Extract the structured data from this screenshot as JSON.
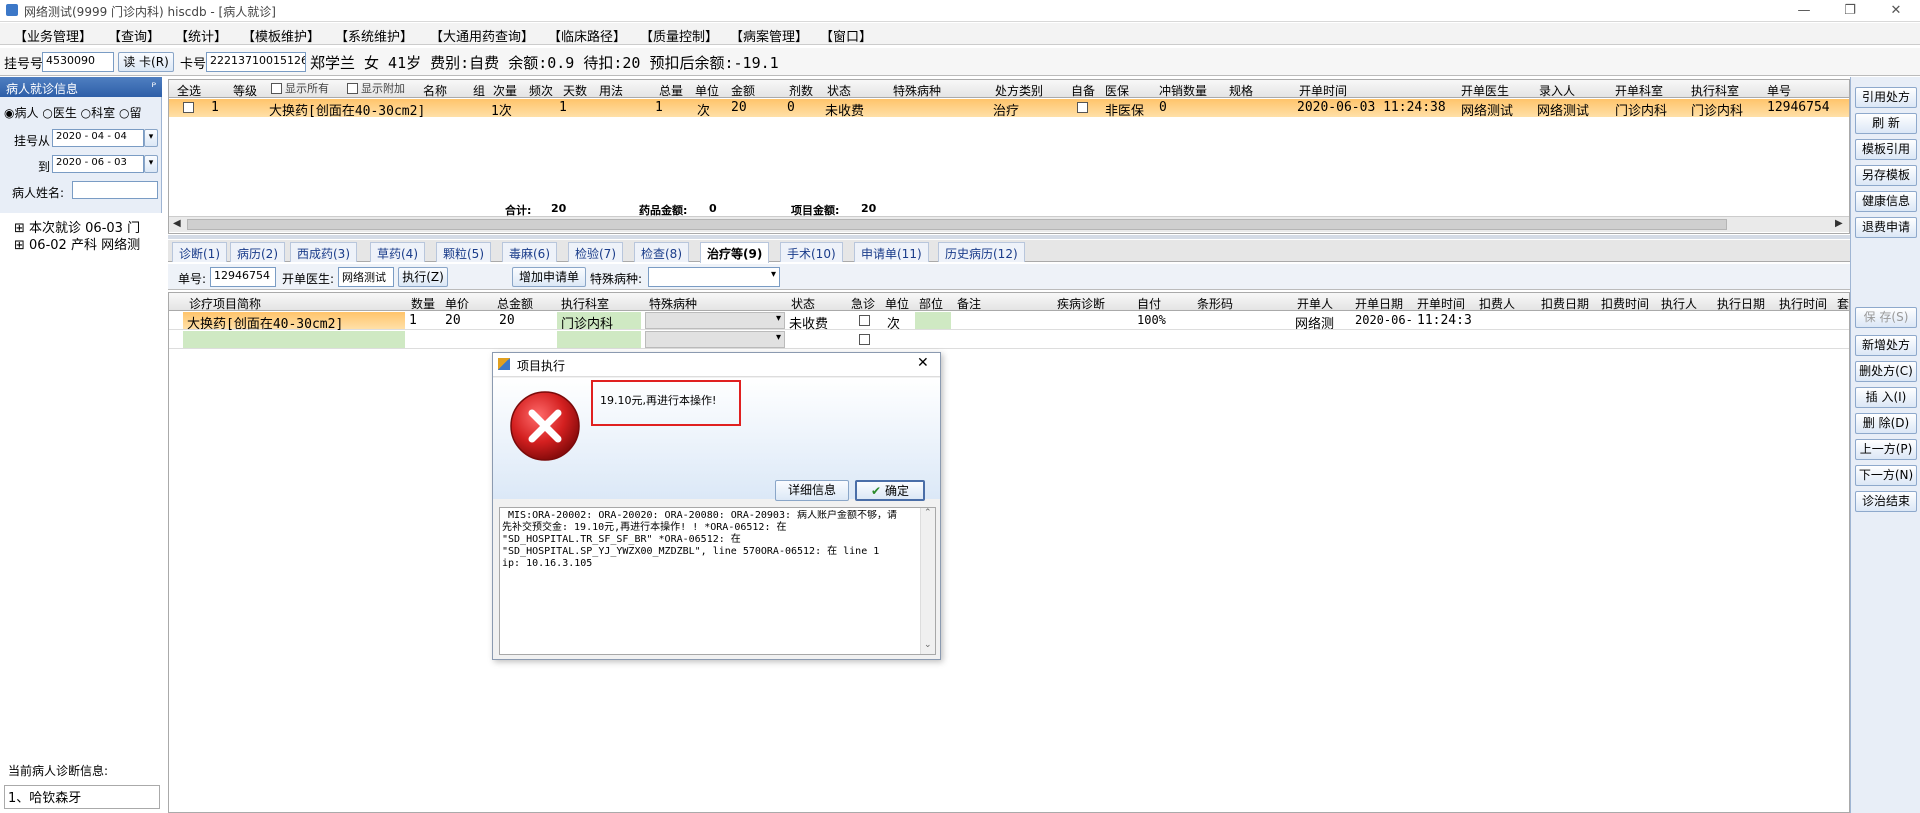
{
  "window": {
    "title": "网络测试(9999 门诊内科)  hiscdb - [病人就诊]",
    "minimize": "—",
    "restore": "❐",
    "close": "✕"
  },
  "menu": [
    "【业务管理】",
    "【查询】",
    "【统计】",
    "【模板维护】",
    "【系统维护】",
    "【大通用药查询】",
    "【临床路径】",
    "【质量控制】",
    "【病案管理】",
    "【窗口】"
  ],
  "patient": {
    "reg_label": "挂号号",
    "reg_no": "4530090",
    "read_card": "读 卡(R)",
    "card_label": "卡号",
    "card_no": "222137100151268",
    "info": "郑学兰  女  41岁  费别:自费  余额:0.9  待扣:20  预扣后余额:-19.1"
  },
  "left": {
    "header": "病人就诊信息",
    "pin": "ᴾ",
    "radios": [
      "病人",
      "医生",
      "科室",
      "留"
    ],
    "from_label": "挂号从",
    "from_date": "2020 - 04 - 04",
    "to_label": "到",
    "to_date": "2020 - 06 - 03",
    "name_label": "病人姓名:",
    "tree": [
      "本次就诊 06-03 门",
      "06-02 产科  网络测"
    ],
    "diag_label": "当前病人诊断信息:",
    "diag_value": "1、哈钦森牙"
  },
  "top_grid": {
    "select_all": "全选",
    "show_all": "显示所有",
    "show_extra": "显示附加",
    "headers": [
      "等级",
      "名称",
      "组",
      "次量",
      "频次",
      "天数",
      "用法",
      "总量",
      "单位",
      "金额",
      "剂数",
      "状态",
      "特殊病种",
      "处方类别",
      "自备",
      "医保",
      "冲销数量",
      "规格",
      "开单时间",
      "开单医生",
      "录入人",
      "开单科室",
      "执行科室",
      "单号"
    ],
    "row": {
      "idx": "1",
      "name": "大换药[创面在40-30cm2]",
      "dose": "1次",
      "freq": "1",
      "total": "1",
      "unit": "次",
      "amount": "20",
      "doses": "0",
      "status": "未收费",
      "category": "治疗",
      "insurance": "非医保",
      "writeoff": "0",
      "time": "2020-06-03 11:24:38",
      "doctor": "网络测试",
      "entered_by": "网络测试",
      "dept": "门诊内科",
      "exec_dept": "门诊内科",
      "order_no": "12946754"
    },
    "totals": {
      "sum_label": "合计:",
      "sum": "20",
      "drug_label": "药品金额:",
      "drug": "0",
      "item_label": "项目金额:",
      "item": "20"
    }
  },
  "tabs": [
    "诊断(1)",
    "病历(2)",
    "西成药(3)",
    "草药(4)",
    "颗粒(5)",
    "毒麻(6)",
    "检验(7)",
    "检查(8)",
    "治疗等(9)",
    "手术(10)",
    "申请单(11)",
    "历史病历(12)"
  ],
  "toolbar": {
    "order_label": "单号:",
    "order_no": "12946754",
    "doctor_label": "开单医生:",
    "doctor": "网络测试",
    "exec": "执行(Z)",
    "add_request": "增加申请单",
    "special_label": "特殊病种:"
  },
  "lower_grid": {
    "headers": [
      "诊疗项目简称",
      "数量",
      "单价",
      "总金额",
      "执行科室",
      "特殊病种",
      "状态",
      "急诊",
      "单位",
      "部位",
      "备注",
      "疾病诊断",
      "自付",
      "条形码",
      "开单人",
      "开单日期",
      "开单时间",
      "扣费人",
      "扣费日期",
      "扣费时间",
      "执行人",
      "执行日期",
      "执行时间",
      "套"
    ],
    "row": {
      "name": "大换药[创面在40-30cm2]",
      "qty": "1",
      "price": "20",
      "total": "20",
      "exec_dept": "门诊内科",
      "status": "未收费",
      "unit": "次",
      "selfpay": "100%",
      "doctor": "网络测",
      "date": "2020-06-",
      "time": "11:24:3"
    }
  },
  "right_buttons": [
    "引用处方",
    "刷 新",
    "模板引用",
    "另存模板",
    "健康信息",
    "退费申请",
    "保 存(S)",
    "新增处方",
    "删处方(C)",
    "插 入(I)",
    "删 除(D)",
    "上一方(P)",
    "下一方(N)",
    "诊治结束"
  ],
  "dialog": {
    "title": "项目执行",
    "close": "✕",
    "message": "19.10元,再进行本操作!",
    "detail_btn": "详细信息",
    "ok_btn": "确定",
    "detail_text": " MIS:ORA-20002: ORA-20020: ORA-20080: ORA-20903: 病人账户金额不够，请\n先补交预交金: 19.10元,再进行本操作! ! *ORA-06512: 在\n\"SD_HOSPITAL.TR_SF_SF_BR\" *ORA-06512: 在\n\"SD_HOSPITAL.SP_YJ_YWZX00_MZDZBL\", line 570ORA-06512: 在 line 1\nip: 10.16.3.105"
  },
  "colors": {
    "accent": "#2e5fa8",
    "highlight_row": "#ffc46b",
    "error_red": "#d42020"
  }
}
